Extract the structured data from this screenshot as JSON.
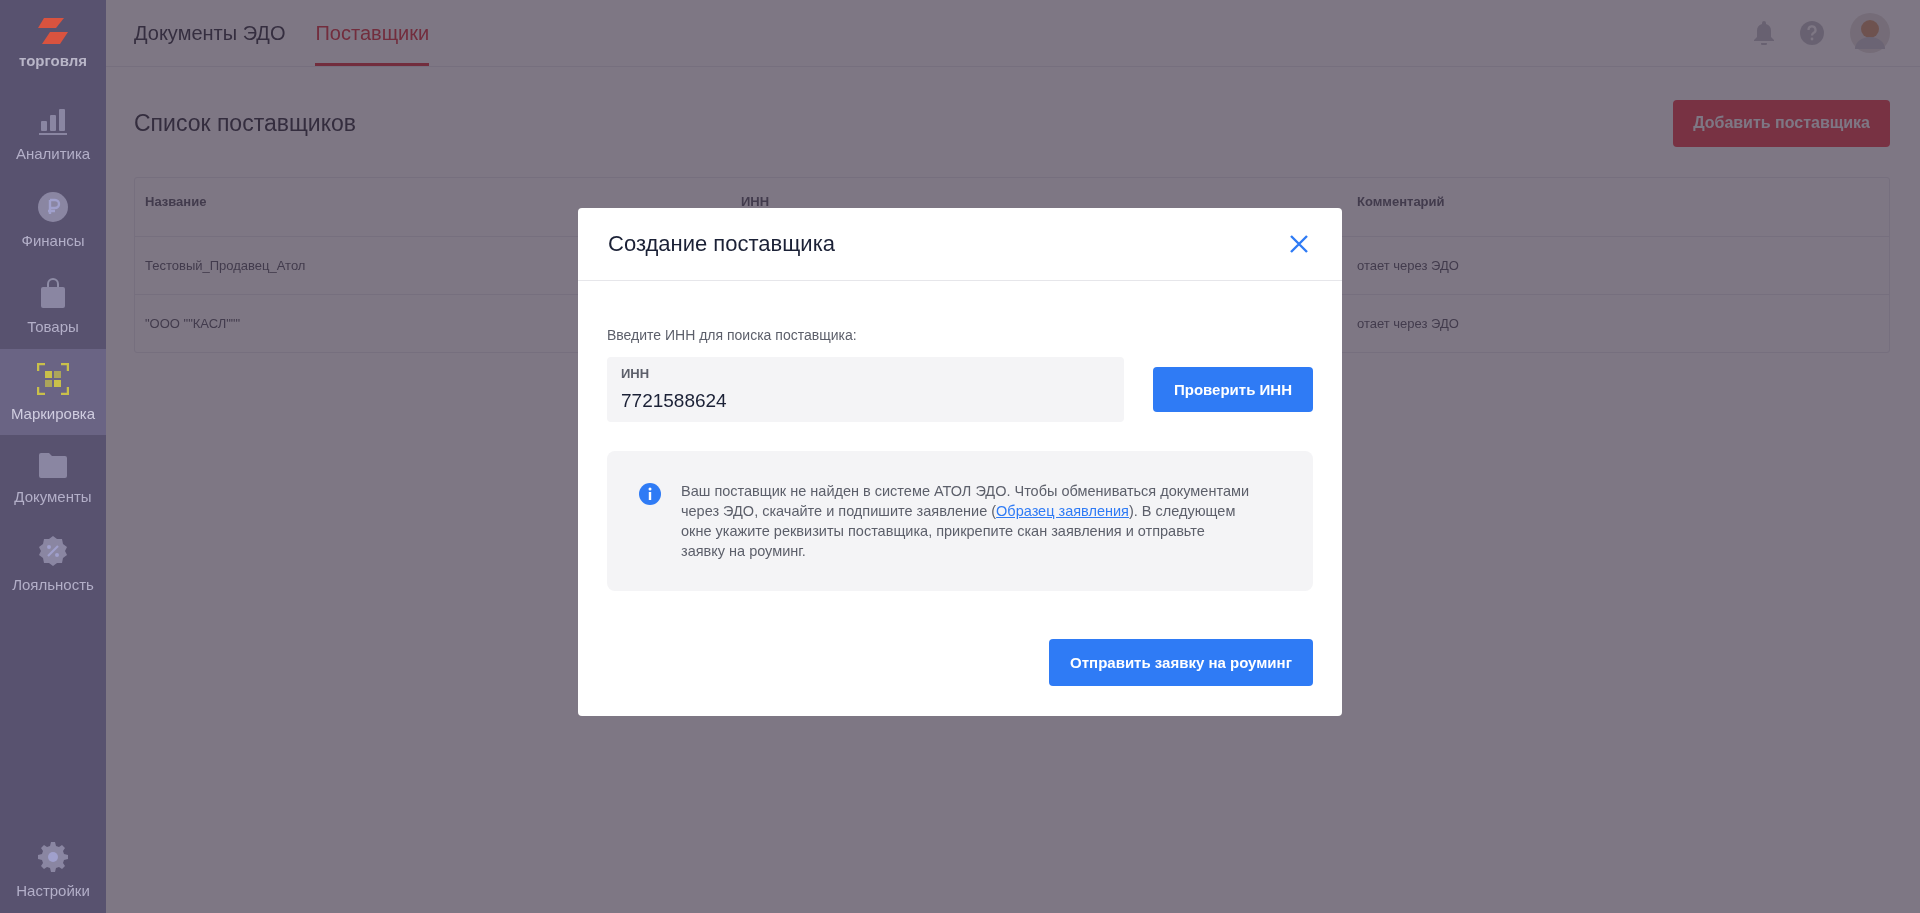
{
  "sidebar": {
    "logo": "торговля",
    "items": [
      {
        "label": "Аналитика",
        "selected": false
      },
      {
        "label": "Финансы",
        "selected": false
      },
      {
        "label": "Товары",
        "selected": false
      },
      {
        "label": "Маркировка",
        "selected": true
      },
      {
        "label": "Документы",
        "selected": false
      },
      {
        "label": "Лояльность",
        "selected": false
      }
    ],
    "footer": {
      "label": "Настройки"
    }
  },
  "tabs": [
    {
      "label": "Документы ЭДО",
      "selected": false
    },
    {
      "label": "Поставщики",
      "selected": true
    }
  ],
  "page": {
    "title": "Список поставщиков",
    "add_button": "Добавить поставщика"
  },
  "table": {
    "columns": [
      "Название",
      "ИНН",
      "Комментарий"
    ],
    "rows": [
      {
        "name": "Тестовый_Продавец_Атол",
        "comment": "отает через ЭДО"
      },
      {
        "name": "\"ООО \"\"КАСЛ\"\"\"",
        "comment": "отает через ЭДО"
      }
    ]
  },
  "modal": {
    "title": "Создание поставщика",
    "prompt": "Введите ИНН для поиска поставщика:",
    "field": {
      "label": "ИНН",
      "value": "7721588624"
    },
    "check_button": "Проверить ИНН",
    "info": {
      "before": "Ваш поставщик не найден в системе АТОЛ ЭДО. Чтобы обмениваться документами через ЭДО, скачайте и подпишите заявление (",
      "link": "Образец заявления",
      "after": "). В следующем окне укажите реквизиты поставщика, прикрепите скан заявления и отправьте заявку на роуминг."
    },
    "submit_button": "Отправить заявку на роуминг"
  }
}
